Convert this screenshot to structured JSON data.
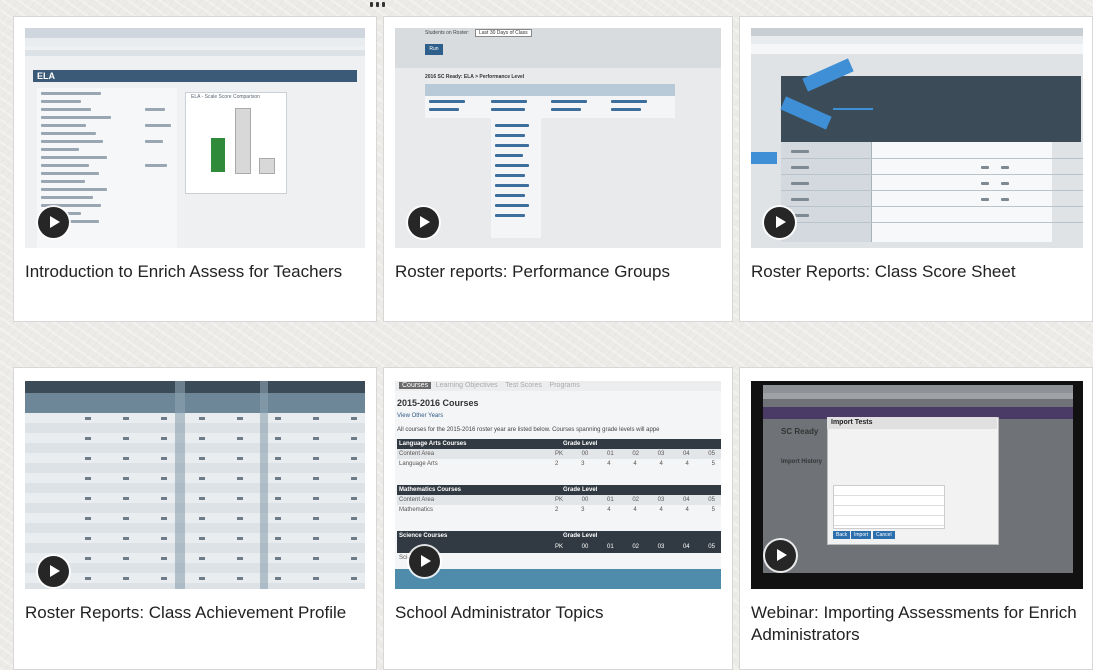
{
  "videos": [
    {
      "title": "Introduction to Enrich Assess for Teachers"
    },
    {
      "title": "Roster reports: Performance Groups"
    },
    {
      "title": "Roster Reports: Class Score Sheet"
    },
    {
      "title": "Roster Reports: Class Achievement Profile"
    },
    {
      "title": "School Administrator Topics"
    },
    {
      "title": "Webinar: Importing Assessments for Enrich Administrators"
    }
  ],
  "thumbs": {
    "t1": {
      "heading": "ELA",
      "chart_title": "ELA - Scale Score Comparison"
    },
    "t2": {
      "select_label": "Students on Roster:",
      "select_value": "Last 30 Days of Class",
      "button": "Run",
      "report_title": "2016 SC Ready: ELA > Performance Level"
    },
    "t5": {
      "tabs": [
        "Courses",
        "Learning Objectives",
        "Test Scores",
        "Programs"
      ],
      "heading": "2015-2016 Courses",
      "link": "View Other Years",
      "note": "All courses for the 2015-2016 roster year are listed below. Courses spanning grade levels will appe",
      "tables": [
        {
          "header": "Language Arts Courses",
          "grade": "Grade Level",
          "area": "Content Area",
          "course": "Language Arts"
        },
        {
          "header": "Mathematics Courses",
          "grade": "Grade Level",
          "area": "Content Area",
          "course": "Mathematics"
        },
        {
          "header": "Science Courses",
          "grade": "Grade Level",
          "area": "",
          "course": "Science"
        }
      ],
      "grades": [
        "PK",
        "00",
        "01",
        "02",
        "03",
        "04",
        "05"
      ],
      "vals": [
        "2",
        "3",
        "4",
        "4",
        "4",
        "4",
        "5"
      ]
    },
    "t6": {
      "dialog_title": "Import Tests",
      "app_title": "SC Ready",
      "sub": "Import History",
      "btn_back": "Back",
      "btn_import": "Import",
      "btn_cancel": "Cancel"
    }
  }
}
